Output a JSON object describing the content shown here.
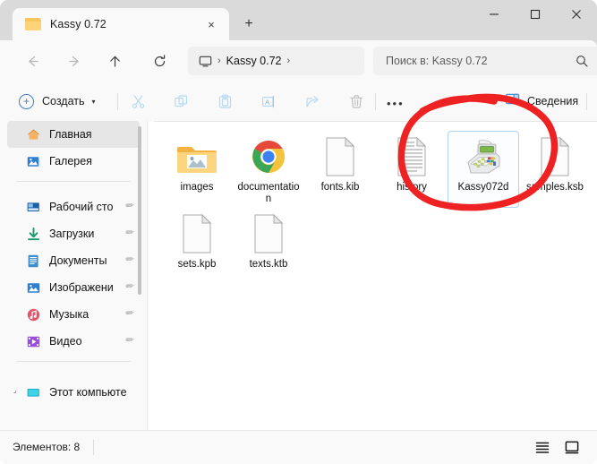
{
  "window": {
    "tab_title": "Kassy 0.72",
    "tab_close_label": "×",
    "new_tab_label": "+",
    "controls": {
      "minimize": "—",
      "maximize": "□",
      "close": "×"
    }
  },
  "nav": {
    "back": "back-arrow",
    "forward": "forward-arrow",
    "up": "up-arrow",
    "refresh": "refresh-icon"
  },
  "address": {
    "root_icon": "monitor-icon",
    "separator": "›",
    "crumb": "Kassy 0.72",
    "trailing_separator": "›"
  },
  "search": {
    "placeholder": "Поиск в: Kassy 0.72",
    "icon": "search-icon"
  },
  "toolbar": {
    "new_label": "Создать",
    "new_caret": "▾",
    "cut": "cut-icon",
    "copy": "copy-icon",
    "paste": "paste-icon",
    "rename": "rename-icon",
    "share": "share-icon",
    "delete": "trash-icon",
    "overflow": "•••",
    "details_label": "Сведения"
  },
  "sidebar": {
    "items": [
      {
        "label": "Главная",
        "icon": "home-icon",
        "selected": true,
        "pinned": false
      },
      {
        "label": "Галерея",
        "icon": "gallery-icon",
        "selected": false,
        "pinned": false
      },
      {
        "label": "Рабочий сто",
        "icon": "desktop-icon",
        "selected": false,
        "pinned": true
      },
      {
        "label": "Загрузки",
        "icon": "downloads-icon",
        "selected": false,
        "pinned": true
      },
      {
        "label": "Документы",
        "icon": "documents-icon",
        "selected": false,
        "pinned": true
      },
      {
        "label": "Изображени",
        "icon": "pictures-icon",
        "selected": false,
        "pinned": true
      },
      {
        "label": "Музыка",
        "icon": "music-icon",
        "selected": false,
        "pinned": true
      },
      {
        "label": "Видео",
        "icon": "video-icon",
        "selected": false,
        "pinned": true
      },
      {
        "label": "Этот компьюте",
        "icon": "this-pc-icon",
        "selected": false,
        "pinned": false
      }
    ],
    "pin_glyph": "✐"
  },
  "files": [
    {
      "name": "images",
      "icon": "folder-images",
      "selected": false
    },
    {
      "name": "documentation",
      "icon": "chrome-html",
      "selected": false
    },
    {
      "name": "fonts.kib",
      "icon": "blank-document",
      "selected": false
    },
    {
      "name": "history",
      "icon": "text-document",
      "selected": false
    },
    {
      "name": "Kassy072d",
      "icon": "cash-register",
      "selected": true
    },
    {
      "name": "samples.ksb",
      "icon": "blank-document",
      "selected": false
    },
    {
      "name": "sets.kpb",
      "icon": "blank-document",
      "selected": false
    },
    {
      "name": "texts.ktb",
      "icon": "blank-document",
      "selected": false
    }
  ],
  "status": {
    "count_text": "Элементов: 8",
    "view_list": "list-view-icon",
    "view_icons": "large-icons-view-icon"
  },
  "annotation": {
    "type": "hand-drawn-circle",
    "color": "#ee2222",
    "target": "Kassy072d"
  },
  "colors": {
    "window_chrome": "#dadada",
    "panel": "#f9f9f9",
    "content": "#ffffff",
    "accent": "#3f7fc1",
    "selection_border": "#aed4f0",
    "annotation_red": "#ee2222"
  }
}
